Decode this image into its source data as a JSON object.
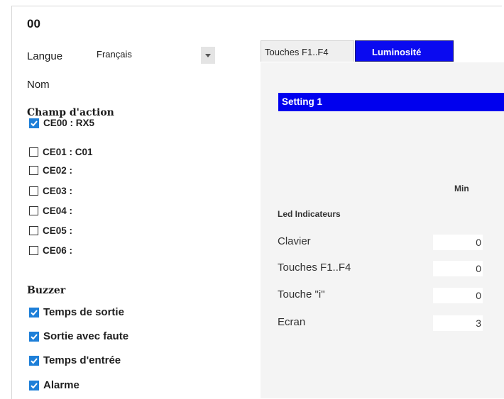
{
  "header": {
    "title": "00"
  },
  "langue": {
    "label": "Langue",
    "value": "Français"
  },
  "nom": {
    "label": "Nom"
  },
  "champ_action": {
    "title": "Champ d'action",
    "items": [
      {
        "label": "CE00 : RX5",
        "checked": true
      },
      {
        "label": "CE01 : C01",
        "checked": false
      },
      {
        "label": "CE02 :",
        "checked": false
      },
      {
        "label": "CE03 :",
        "checked": false
      },
      {
        "label": "CE04 :",
        "checked": false
      },
      {
        "label": "CE05 :",
        "checked": false
      },
      {
        "label": "CE06 :",
        "checked": false
      }
    ]
  },
  "buzzer": {
    "title": "Buzzer",
    "items": [
      {
        "label": "Temps de sortie",
        "checked": true
      },
      {
        "label": "Sortie avec faute",
        "checked": true
      },
      {
        "label": "Temps d'entrée",
        "checked": true
      },
      {
        "label": "Alarme",
        "checked": true
      }
    ]
  },
  "tabs": [
    {
      "label": "Touches F1..F4",
      "active": false
    },
    {
      "label": "Luminosité",
      "active": true
    }
  ],
  "luminosite": {
    "setting_title": "Setting 1",
    "column_min": "Min",
    "group_label": "Led Indicateurs",
    "rows": [
      {
        "label": "Clavier",
        "min": "0"
      },
      {
        "label": "Touches F1..F4",
        "min": "0"
      },
      {
        "label": "Touche \"i\"",
        "min": "0"
      },
      {
        "label": "Ecran",
        "min": "3"
      }
    ]
  },
  "colors": {
    "accent": "#0000ee",
    "checkbox": "#1e7fd8",
    "panel_bg": "#f4f4f4"
  }
}
